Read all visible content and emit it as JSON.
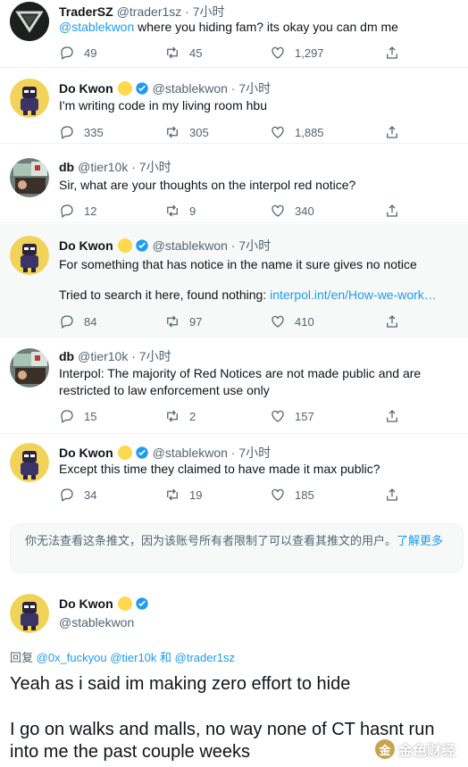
{
  "tweets": [
    {
      "name": "TraderSZ",
      "handle": "@trader1sz · 7小时",
      "text_mention": "@stablekwon",
      "text": " where you hiding fam? its okay you can dm me",
      "replies": "49",
      "retweets": "45",
      "likes": "1,297"
    },
    {
      "name": "Do Kwon",
      "handle": "@stablekwon · 7小时",
      "text": "I'm writing code in my living room hbu",
      "replies": "335",
      "retweets": "305",
      "likes": "1,885"
    },
    {
      "name": "db",
      "handle": "@tier10k · 7小时",
      "text": "Sir, what are your thoughts on the interpol red notice?",
      "replies": "12",
      "retweets": "9",
      "likes": "340"
    },
    {
      "name": "Do Kwon",
      "handle": "@stablekwon · 7小时",
      "text": "For something that has notice in the name it sure gives no notice",
      "text2": "Tried to search it here, found nothing: ",
      "link": "interpol.int/en/How-we-work…",
      "replies": "84",
      "retweets": "97",
      "likes": "410"
    },
    {
      "name": "db",
      "handle": "@tier10k · 7小时",
      "text": "Interpol: The majority of Red Notices are not made public and are restricted to law enforcement use only",
      "replies": "15",
      "retweets": "2",
      "likes": "157"
    },
    {
      "name": "Do Kwon",
      "handle": "@stablekwon · 7小时",
      "text": "Except this time they claimed to have made it max public?",
      "replies": "34",
      "retweets": "19",
      "likes": "185"
    }
  ],
  "notice": {
    "text": "你无法查看这条推文，因为该账号所有者限制了可以查看其推文的用户。",
    "more": "了解更多"
  },
  "main": {
    "name": "Do Kwon",
    "handle": "@stablekwon",
    "replying_prefix": "回复 ",
    "replying_users": "@0x_fuckyou @tier10k 和 @trader1sz",
    "line1": "Yeah as i said im making zero effort to hide",
    "line2": "I go on walks and malls, no way none of CT hasnt run into me the past couple weeks"
  },
  "watermark": {
    "text": "金色财经",
    "coin": "金"
  },
  "colors": {
    "accent": "#1d9bf0",
    "secondary_text": "#536471",
    "highlight_bg": "#f7f9f9"
  },
  "icons": {
    "reply": "reply-icon",
    "retweet": "retweet-icon",
    "like": "heart-icon",
    "share": "share-icon",
    "verified": "verified-badge-icon"
  }
}
